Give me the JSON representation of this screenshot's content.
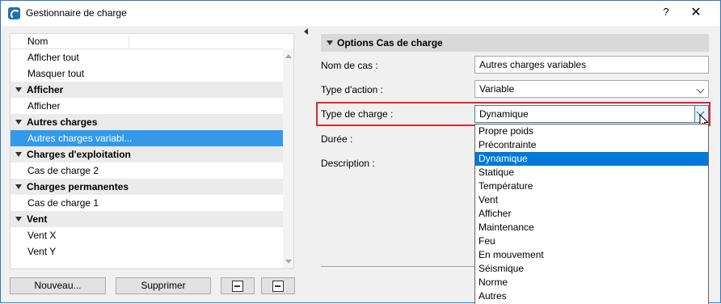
{
  "window": {
    "title": "Gestionnaire de charge",
    "help_label": "?",
    "close_label": "✕"
  },
  "list": {
    "column_header": "Nom",
    "rows": [
      {
        "label": "Afficher tout",
        "kind": "item"
      },
      {
        "label": "Masquer tout",
        "kind": "item"
      },
      {
        "label": "Afficher",
        "kind": "group"
      },
      {
        "label": "Afficher",
        "kind": "item"
      },
      {
        "label": "Autres charges",
        "kind": "group"
      },
      {
        "label": "Autres charges variabl...",
        "kind": "selected"
      },
      {
        "label": "Charges d'exploitation",
        "kind": "group"
      },
      {
        "label": "Cas de charge 2",
        "kind": "item"
      },
      {
        "label": "Charges permanentes",
        "kind": "group"
      },
      {
        "label": "Cas de charge 1",
        "kind": "item"
      },
      {
        "label": "Vent",
        "kind": "group"
      },
      {
        "label": "Vent X",
        "kind": "item"
      },
      {
        "label": "Vent Y",
        "kind": "item"
      }
    ]
  },
  "buttons": {
    "new": "Nouveau...",
    "delete": "Supprimer"
  },
  "options": {
    "section_title": "Options Cas de charge",
    "case_name_label": "Nom de cas :",
    "case_name_value": "Autres charges variables",
    "action_type_label": "Type d'action :",
    "action_type_value": "Variable",
    "load_type_label": "Type de charge :",
    "load_type_value": "Dynamique",
    "duration_label": "Durée :",
    "description_label": "Description :"
  },
  "dropdown": {
    "options": [
      "Propre poids",
      "Précontrainte",
      "Dynamique",
      "Statique",
      "Température",
      "Vent",
      "Afficher",
      "Maintenance",
      "Feu",
      "En mouvement",
      "Séismique",
      "Norme",
      "Autres"
    ],
    "selected_index": 2
  },
  "colors": {
    "selection": "#3399e8",
    "dropdown_selection": "#0078d7",
    "highlight": "#e0272e"
  }
}
